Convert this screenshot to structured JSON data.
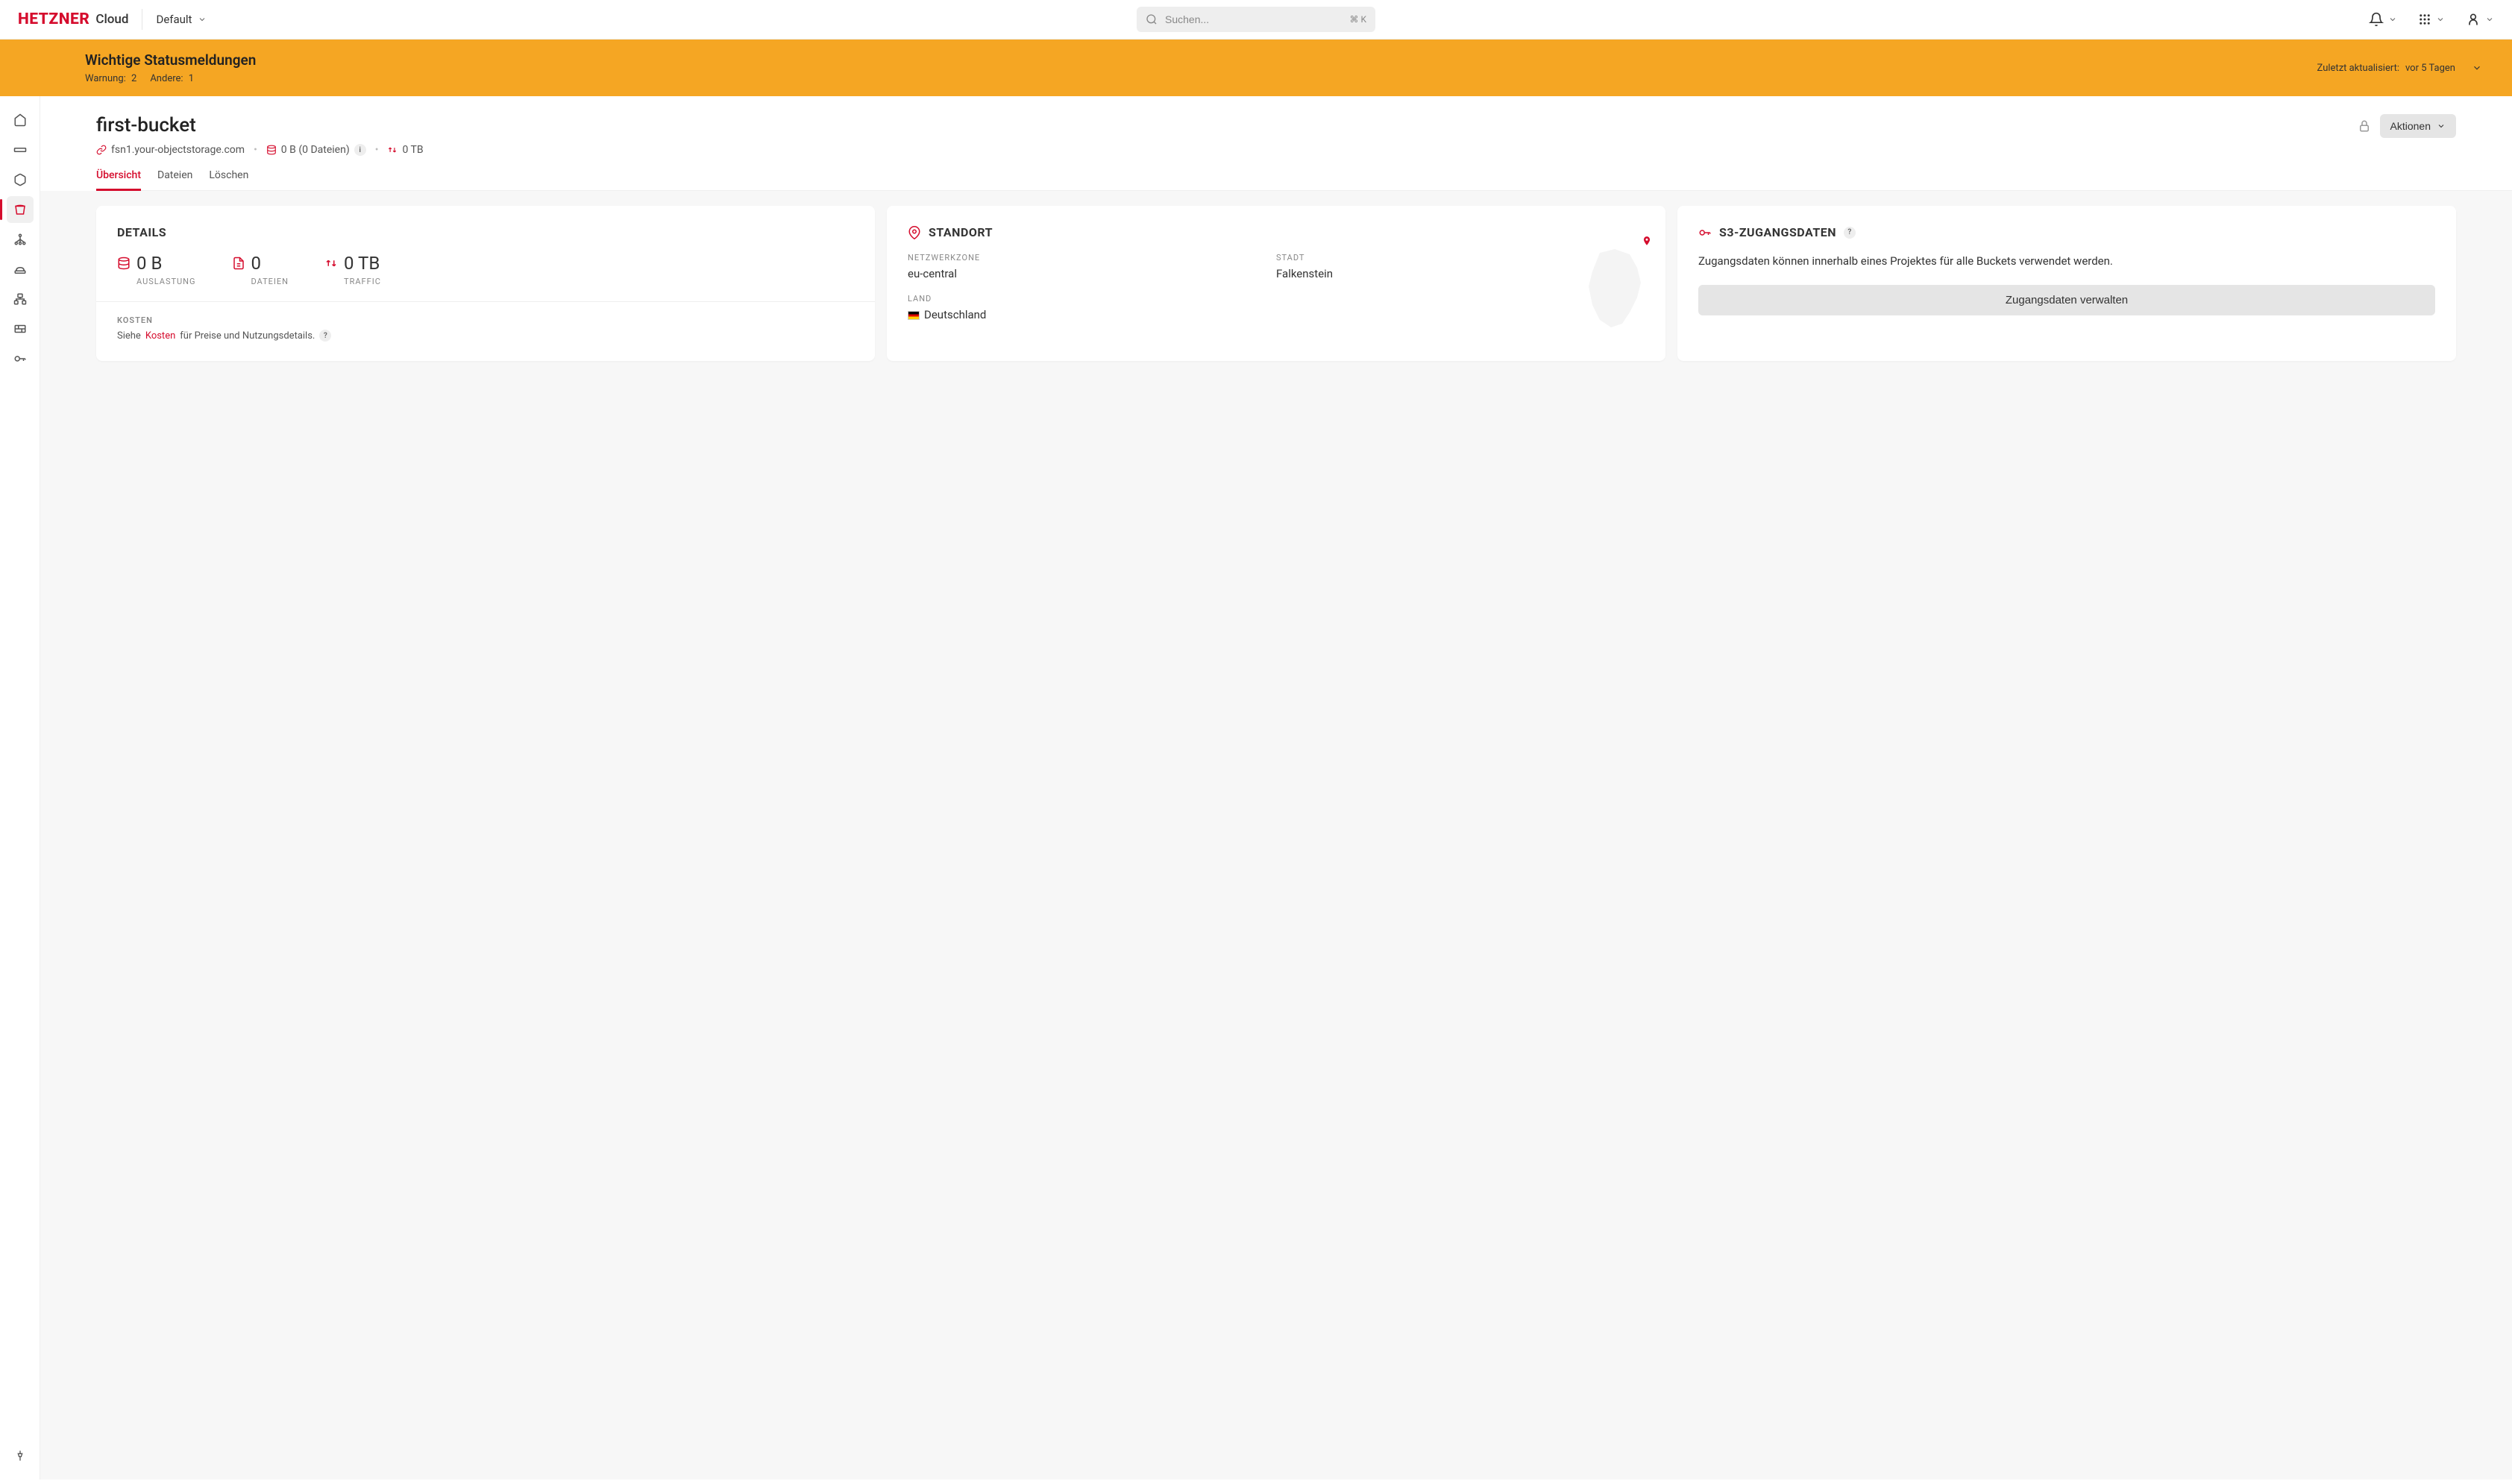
{
  "header": {
    "brand": "HETZNER",
    "product": "Cloud",
    "project_label": "Default",
    "search_placeholder": "Suchen...",
    "search_kbd": "⌘ K"
  },
  "status_banner": {
    "title": "Wichtige Statusmeldungen",
    "warn_label": "Warnung:",
    "warn_count": "2",
    "other_label": "Andere:",
    "other_count": "1",
    "updated_label": "Zuletzt aktualisiert:",
    "updated_value": "vor 5 Tagen"
  },
  "page": {
    "title": "first-bucket",
    "endpoint": "fsn1.your-objectstorage.com",
    "size": "0 B (0 Dateien)",
    "traffic": "0 TB",
    "actions_label": "Aktionen"
  },
  "tabs": [
    {
      "label": "Übersicht",
      "active": true
    },
    {
      "label": "Dateien",
      "active": false
    },
    {
      "label": "Löschen",
      "active": false
    }
  ],
  "details_card": {
    "title": "DETAILS",
    "stats": {
      "usage_value": "0 B",
      "usage_label": "AUSLASTUNG",
      "files_value": "0",
      "files_label": "DATEIEN",
      "traffic_value": "0 TB",
      "traffic_label": "TRAFFIC"
    },
    "cost_label": "KOSTEN",
    "cost_prefix": "Siehe",
    "cost_link": "Kosten",
    "cost_suffix": "für Preise und Nutzungsdetails."
  },
  "location_card": {
    "title": "STANDORT",
    "zone_label": "NETZWERKZONE",
    "zone_value": "eu-central",
    "city_label": "STADT",
    "city_value": "Falkenstein",
    "country_label": "LAND",
    "country_value": "Deutschland"
  },
  "credentials_card": {
    "title": "S3-ZUGANGSDATEN",
    "description": "Zugangsdaten können innerhalb eines Projektes für alle Buckets verwendet werden.",
    "button": "Zugangsdaten verwalten"
  }
}
